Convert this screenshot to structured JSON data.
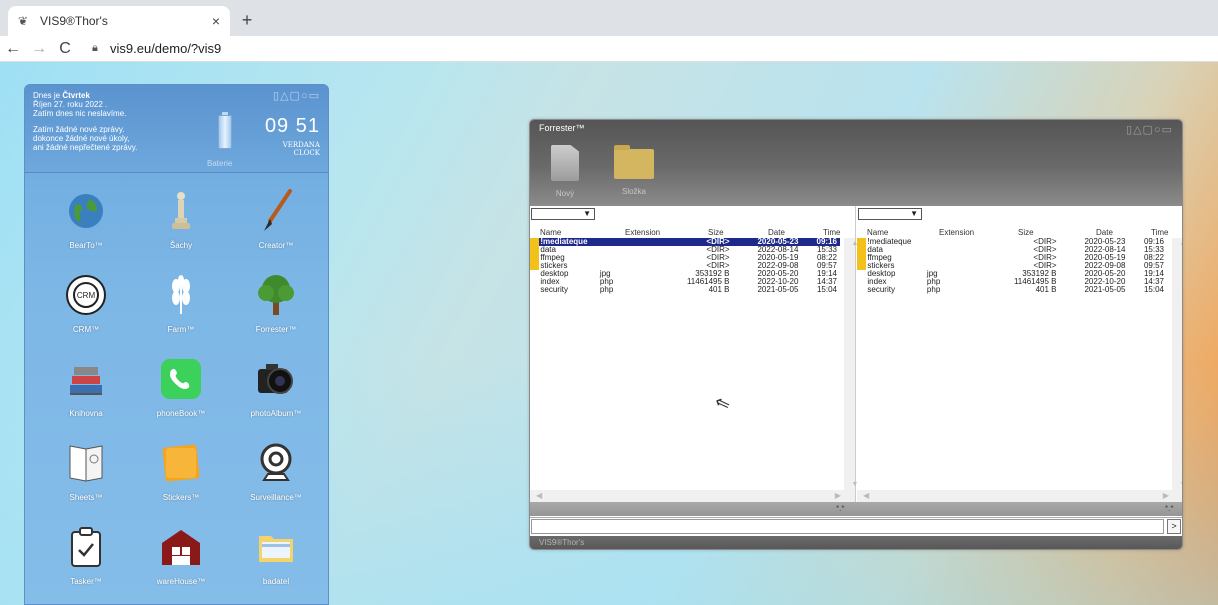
{
  "browser": {
    "tab_title": "VIS9®Thor's",
    "tab_close": "×",
    "new_tab": "+",
    "url": "vis9.eu/demo/?vis9",
    "back": "←",
    "forward": "→",
    "reload": "C"
  },
  "panel": {
    "line1": "Dnes je ",
    "day": "Čtvrtek",
    "line2": "Říjen 27. roku 2022 .",
    "line3": "Zatím dnes nic neslavíme.",
    "line4": "Zatím žádné nové zprávy.",
    "line5": "dokonce žádné nové úkoly,",
    "line6": "ani žádné nepřečtené zprávy.",
    "clock": "09 51",
    "clock_name_1": "VERDANA",
    "clock_name_2": "CLOCK",
    "battery_label": "Baterie",
    "apps": [
      {
        "label": "BearTo™",
        "icon": "globe-icon"
      },
      {
        "label": "Šachy",
        "icon": "chess-icon"
      },
      {
        "label": "Creator™",
        "icon": "brush-icon"
      },
      {
        "label": "CRM™",
        "icon": "crm-icon"
      },
      {
        "label": "Farm™",
        "icon": "wheat-icon"
      },
      {
        "label": "Forrester™",
        "icon": "tree-icon"
      },
      {
        "label": "Knihovna",
        "icon": "books-icon"
      },
      {
        "label": "phoneBook™",
        "icon": "phone-icon"
      },
      {
        "label": "photoAlbum™",
        "icon": "camera-icon"
      },
      {
        "label": "Sheets™",
        "icon": "sheets-icon"
      },
      {
        "label": "Stickers™",
        "icon": "sticker-icon"
      },
      {
        "label": "Surveillance™",
        "icon": "webcam-icon"
      },
      {
        "label": "Tasker™",
        "icon": "clipboard-icon"
      },
      {
        "label": "wareHouse™",
        "icon": "warehouse-icon"
      },
      {
        "label": "badatel",
        "icon": "folder-icon"
      }
    ]
  },
  "forrester": {
    "title": "Forrester™",
    "tool_new": "Nový",
    "tool_folder": "Složka",
    "footer": "VIS9®Thor's",
    "filter": "*.*",
    "go": ">",
    "columns": {
      "name": "Name",
      "ext": "Extension",
      "size": "Size",
      "date": "Date",
      "time": "Time"
    },
    "files": [
      {
        "name": "!mediateque",
        "ext": "",
        "size": "<DIR>",
        "date": "2020-05-23",
        "time": "09:16",
        "dir": true
      },
      {
        "name": "data",
        "ext": "",
        "size": "<DIR>",
        "date": "2022-08-14",
        "time": "15:33",
        "dir": true
      },
      {
        "name": "ffmpeg",
        "ext": "",
        "size": "<DIR>",
        "date": "2020-05-19",
        "time": "08:22",
        "dir": true
      },
      {
        "name": "stickers",
        "ext": "",
        "size": "<DIR>",
        "date": "2022-09-08",
        "time": "09:57",
        "dir": true
      },
      {
        "name": "desktop",
        "ext": "jpg",
        "size": "353192 B",
        "date": "2020-05-20",
        "time": "19:14",
        "dir": false
      },
      {
        "name": "index",
        "ext": "php",
        "size": "11461495 B",
        "date": "2022-10-20",
        "time": "14:37",
        "dir": false
      },
      {
        "name": "security",
        "ext": "php",
        "size": "401 B",
        "date": "2021-05-05",
        "time": "15:04",
        "dir": false
      }
    ]
  }
}
